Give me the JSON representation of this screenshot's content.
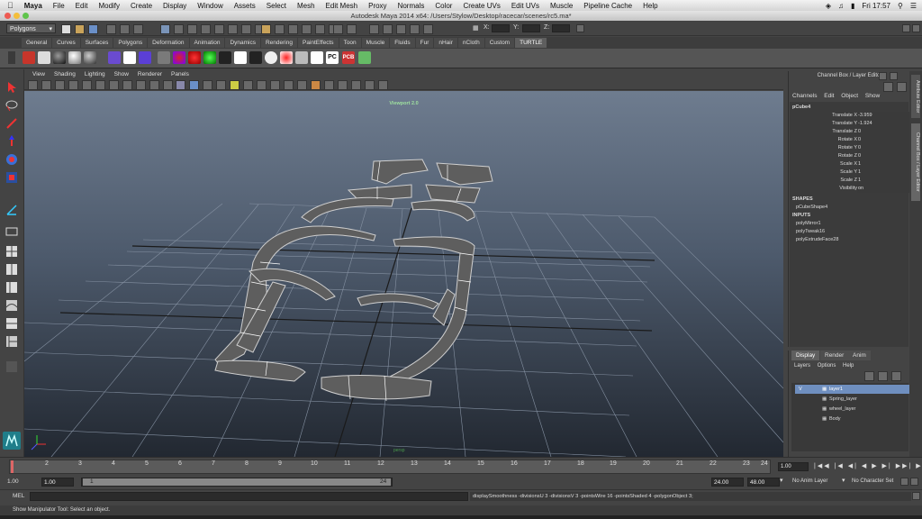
{
  "menubar": {
    "apple": "",
    "app_name": "Maya",
    "items": [
      "File",
      "Edit",
      "Modify",
      "Create",
      "Display",
      "Window",
      "Assets",
      "Select",
      "Mesh",
      "Edit Mesh",
      "Proxy",
      "Normals",
      "Color",
      "Create UVs",
      "Edit UVs",
      "Muscle",
      "Pipeline Cache",
      "Help"
    ],
    "clock": "Fri 17:57"
  },
  "window_title": "Autodesk Maya 2014 x64: /Users/Stylow/Desktop/racecar/scenes/rc5.ma*",
  "statusline": {
    "menu_set": "Polygons",
    "x_label": "X:",
    "y_label": "Y:",
    "z_label": "Z:"
  },
  "shelf": {
    "tabs": [
      "General",
      "Curves",
      "Surfaces",
      "Polygons",
      "Deformation",
      "Animation",
      "Dynamics",
      "Rendering",
      "PaintEffects",
      "Toon",
      "Muscle",
      "Fluids",
      "Fur",
      "nHair",
      "nCloth",
      "Custom",
      "TURTLE"
    ],
    "active_tab": "TURTLE",
    "icon_labels": [
      "PC",
      "PCB"
    ]
  },
  "viewport": {
    "menus": [
      "View",
      "Shading",
      "Lighting",
      "Show",
      "Renderer",
      "Panels"
    ],
    "renderer_label": "Viewport 2.0",
    "camera_label": "persp"
  },
  "channelbox": {
    "title": "Channel Box / Layer Editor",
    "menus": [
      "Channels",
      "Edit",
      "Object",
      "Show"
    ],
    "object": "pCube4",
    "attrs": [
      {
        "name": "Translate X",
        "value": "-3.959"
      },
      {
        "name": "Translate Y",
        "value": "-1.924"
      },
      {
        "name": "Translate Z",
        "value": "0"
      },
      {
        "name": "Rotate X",
        "value": "0"
      },
      {
        "name": "Rotate Y",
        "value": "0"
      },
      {
        "name": "Rotate Z",
        "value": "0"
      },
      {
        "name": "Scale X",
        "value": "1"
      },
      {
        "name": "Scale Y",
        "value": "1"
      },
      {
        "name": "Scale Z",
        "value": "1"
      },
      {
        "name": "Visibility",
        "value": "on"
      }
    ],
    "shapes_header": "SHAPES",
    "shape": "pCubeShape4",
    "inputs_header": "INPUTS",
    "inputs": [
      "polyMirror1",
      "polyTweak16",
      "polyExtrudeFace28"
    ]
  },
  "sidetabs": [
    "Attribute Editor",
    "Channel Box / Layer Editor"
  ],
  "layereditor": {
    "tabs": [
      "Display",
      "Render",
      "Anim"
    ],
    "active_tab": "Display",
    "menus": [
      "Layers",
      "Options",
      "Help"
    ],
    "visible_flag": "V",
    "layers": [
      "layer1",
      "Spring_layer",
      "wheel_layer",
      "Body"
    ]
  },
  "timeline": {
    "ticks": [
      "1",
      "2",
      "3",
      "4",
      "5",
      "6",
      "7",
      "8",
      "9",
      "10",
      "11",
      "12",
      "13",
      "14",
      "15",
      "16",
      "17",
      "18",
      "19",
      "20",
      "21",
      "22",
      "23",
      "24"
    ],
    "current_frame": "1.00",
    "playback_icons": [
      "|◀◀",
      "|◀",
      "◀|",
      "◀",
      "▶",
      "▶|",
      "▶▶|",
      "▶▶"
    ]
  },
  "rangeslider": {
    "start": "1.00",
    "playback_start": "1.00",
    "range_start": "1",
    "range_end": "24",
    "playback_end": "24.00",
    "end": "48.00",
    "anim_layer": "No Anim Layer",
    "character_set": "No Character Set"
  },
  "cmdline": {
    "label": "MEL",
    "result": "displaySmoothness -divisionsU 3 -divisionsV 3 -pointsWire 16 -pointsShaded 4 -polygonObject 3;"
  },
  "helpline": "Show Manipulator Tool: Select an object.",
  "colors": {
    "accent_blue": "#6f8fbf",
    "viewport_top": "#6e7c8f",
    "viewport_bottom": "#222831",
    "label_green": "#9fe09f"
  }
}
